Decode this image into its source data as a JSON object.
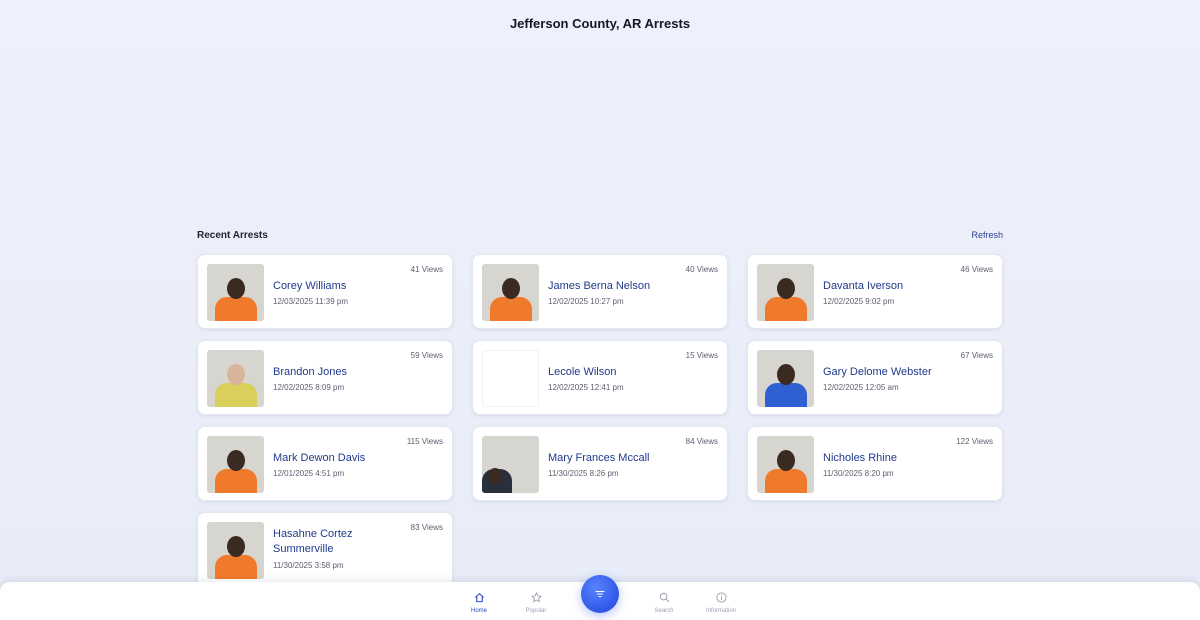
{
  "header": {
    "title": "Jefferson County, AR Arrests"
  },
  "section": {
    "title": "Recent Arrests",
    "refresh_label": "Refresh"
  },
  "arrests": [
    {
      "name": "Corey Williams",
      "date": "12/03/2025 11:39 pm",
      "views": "41 Views",
      "has_photo": true
    },
    {
      "name": "James Berna Nelson",
      "date": "12/02/2025 10:27 pm",
      "views": "40 Views",
      "has_photo": true
    },
    {
      "name": "Davanta Iverson",
      "date": "12/02/2025 9:02 pm",
      "views": "46 Views",
      "has_photo": true
    },
    {
      "name": "Brandon Jones",
      "date": "12/02/2025 8:09 pm",
      "views": "59 Views",
      "has_photo": true
    },
    {
      "name": "Lecole Wilson",
      "date": "12/02/2025 12:41 pm",
      "views": "15 Views",
      "has_photo": false
    },
    {
      "name": "Gary Delome Webster",
      "date": "12/02/2025 12:05 am",
      "views": "67 Views",
      "has_photo": true
    },
    {
      "name": "Mark Dewon Davis",
      "date": "12/01/2025 4:51 pm",
      "views": "115 Views",
      "has_photo": true
    },
    {
      "name": "Mary Frances Mccall",
      "date": "11/30/2025 8:26 pm",
      "views": "84 Views",
      "has_photo": true
    },
    {
      "name": "Nicholes Rhine",
      "date": "11/30/2025 8:20 pm",
      "views": "122 Views",
      "has_photo": true
    },
    {
      "name": "Hasahne Cortez Summerville",
      "date": "11/30/2025 3:58 pm",
      "views": "83 Views",
      "has_photo": true
    }
  ],
  "bottom_nav": {
    "items": [
      {
        "label": "Home",
        "icon": "home-icon",
        "active": true
      },
      {
        "label": "Popular",
        "icon": "star-icon",
        "active": false
      },
      {
        "label": "Search",
        "icon": "search-icon",
        "active": false
      },
      {
        "label": "Information",
        "icon": "info-icon",
        "active": false
      }
    ],
    "fab_icon": "filter-icon"
  },
  "colors": {
    "accent": "#2e48c8",
    "name_link": "#213a8c",
    "uniform": "#f07a2c"
  }
}
